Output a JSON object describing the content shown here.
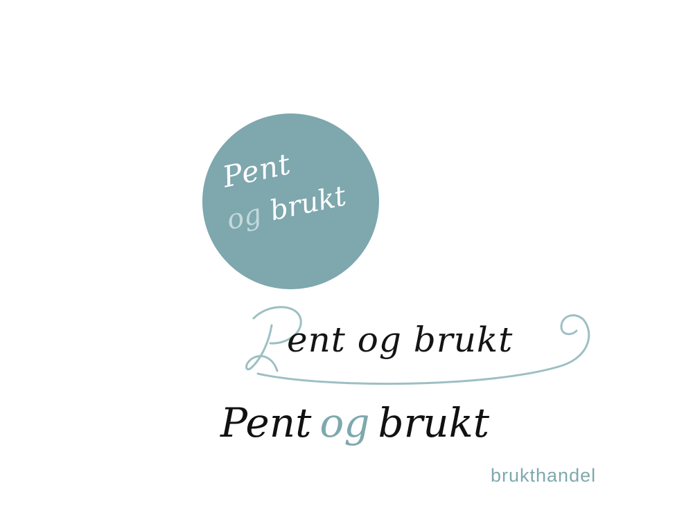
{
  "colors": {
    "teal": "#7ea7ae",
    "light_teal": "#c4d8db",
    "swash": "#9dbfc3",
    "ink": "#111111",
    "tagline": "#7ea8ae"
  },
  "logo_circle": {
    "line1": "Pent",
    "line2_og": "og",
    "line2_brukt": "brukt"
  },
  "swash_logo": {
    "initial": "P",
    "rest": "ent og brukt"
  },
  "wordmark": {
    "pent": "Pent",
    "og": "og",
    "brukt": "brukt",
    "tagline": "brukthandel"
  }
}
